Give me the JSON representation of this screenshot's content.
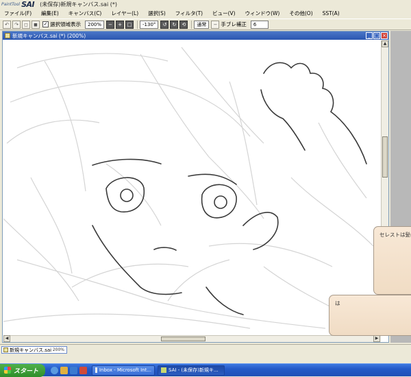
{
  "app": {
    "logo_small": "PaintTool",
    "logo_big": "SAI",
    "title": "(未保存)新規キャンバス.sai (*)"
  },
  "menu": [
    "ファイル(F)",
    "編集(E)",
    "キャンバス(C)",
    "レイヤー(L)",
    "選択(S)",
    "フィルタ(T)",
    "ビュー(V)",
    "ウィンドウ(W)",
    "その他(O)",
    "SST(A)"
  ],
  "toolbar": {
    "selection_display_label": "選択領域表示",
    "selection_display_checked": true,
    "zoom_value": "200%",
    "rotation_value": "-130°",
    "blend_mode": "通常",
    "stabilizer_label": "手ブレ補正",
    "stabilizer_value": "6"
  },
  "document": {
    "title": "新規キャンバス.sai (*) (200%)",
    "tab_name": "新規キャンバス.sai",
    "tab_zoom": "200%",
    "vscroll_position": 0.35,
    "hscroll_position": 0.45
  },
  "bubbles": {
    "bubble1_text": "セレストは髪ば",
    "bubble2_text": "は"
  },
  "taskbar": {
    "start_label": "スタート",
    "tasks": [
      {
        "label": "Inbox - Microsoft Int...",
        "active": false
      },
      {
        "label": "SAI - (未保存)新規キ...",
        "active": true
      }
    ]
  },
  "colors": {
    "title_bar_blue": "#2b56b0",
    "close_red": "#d0443a",
    "bubble_peach": "#f4e2cc",
    "taskbar_blue": "#245ac8",
    "start_green": "#3a9a34"
  }
}
